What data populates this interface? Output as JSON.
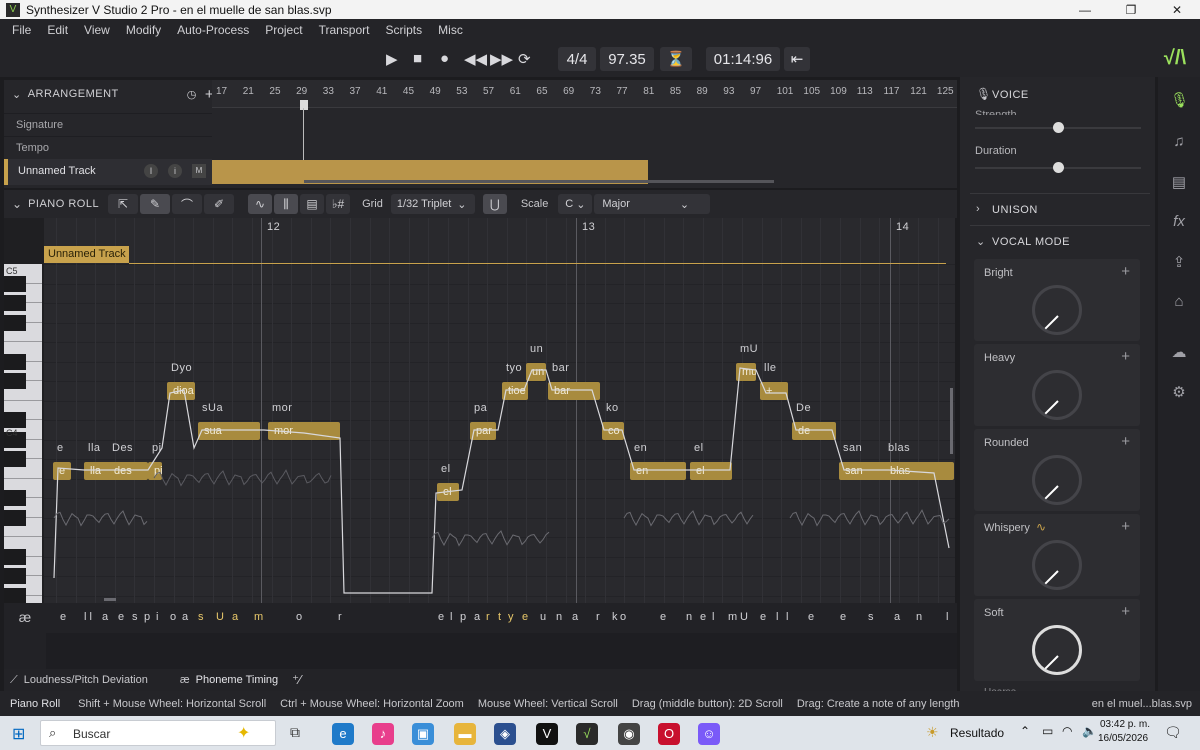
{
  "window": {
    "title": "Synthesizer V Studio 2 Pro - en el muelle de san blas.svp"
  },
  "menu": [
    "File",
    "Edit",
    "View",
    "Modify",
    "Auto-Process",
    "Project",
    "Transport",
    "Scripts",
    "Misc"
  ],
  "transport": {
    "time_signature": "4/4",
    "tempo": "97.35",
    "position": "01:14:96"
  },
  "arrangement": {
    "title": "ARRANGEMENT",
    "rows": [
      "Signature",
      "Tempo"
    ],
    "track_name": "Unnamed Track",
    "track_btns": [
      "I",
      "i",
      "M"
    ],
    "ruler": [
      "17",
      "21",
      "25",
      "29",
      "33",
      "37",
      "41",
      "45",
      "49",
      "53",
      "57",
      "61",
      "65",
      "69",
      "73",
      "77",
      "81",
      "85",
      "89",
      "93",
      "97",
      "101",
      "105",
      "109",
      "113",
      "117",
      "121",
      "125"
    ]
  },
  "piano_roll": {
    "title": "PIANO ROLL",
    "grid_label": "Grid",
    "grid_value": "1/32 Triplet",
    "scale_label": "Scale",
    "scale_key": "C",
    "scale_mode": "Major",
    "bars": [
      "12",
      "13",
      "14"
    ],
    "track_tag": "Unnamed Track",
    "key_c5": "C5",
    "key_c4": "C4",
    "notes": [
      {
        "lyric": "e",
        "phon": "e"
      },
      {
        "lyric": "lla",
        "phon": "lla"
      },
      {
        "lyric": "des",
        "phon": "Des"
      },
      {
        "lyric": "pi",
        "phon": "pi"
      },
      {
        "lyric": "dioa",
        "phon": "Dyo"
      },
      {
        "lyric": "sua",
        "phon": "sUa"
      },
      {
        "lyric": "mor",
        "phon": "mor"
      },
      {
        "lyric": "el",
        "phon": "el"
      },
      {
        "lyric": "par",
        "phon": "pa"
      },
      {
        "lyric": "tioe",
        "phon": "tyo"
      },
      {
        "lyric": "un",
        "phon": "un"
      },
      {
        "lyric": "bar",
        "phon": "bar"
      },
      {
        "lyric": "co",
        "phon": "ko"
      },
      {
        "lyric": "en",
        "phon": "en"
      },
      {
        "lyric": "el",
        "phon": "el"
      },
      {
        "lyric": "mu",
        "phon": "mU"
      },
      {
        "lyric": "+",
        "phon": "lle"
      },
      {
        "lyric": "de",
        "phon": "De"
      },
      {
        "lyric": "san",
        "phon": "san"
      },
      {
        "lyric": "blas",
        "phon": "blas"
      }
    ],
    "phoneme_lane": [
      "e",
      "l l",
      "a",
      "e",
      "s",
      "p",
      "i",
      "o",
      "a",
      "s",
      "U",
      "a",
      "m",
      "o",
      "r",
      "e",
      "l",
      "p",
      "a",
      "r",
      "t",
      "y",
      "e",
      "u",
      "n",
      "a",
      "r",
      "k",
      "o",
      "e",
      "n",
      "e",
      "l",
      "m",
      "U",
      "e",
      "l",
      "l",
      "e",
      "e",
      "s",
      "a",
      "n",
      "l",
      "a",
      "s"
    ]
  },
  "tabs": [
    "Loudness/Pitch Deviation",
    "Phoneme Timing"
  ],
  "voice": {
    "title": "VOICE",
    "strength": "Strength",
    "duration": "Duration",
    "unison": "UNISON",
    "vocal_mode": "VOCAL MODE",
    "modes": [
      "Bright",
      "Heavy",
      "Rounded",
      "Whispery",
      "Soft"
    ],
    "more": "Hoarse"
  },
  "status": {
    "left": "Piano Roll",
    "hints": [
      "Shift + Mouse Wheel: Horizontal Scroll",
      "Ctrl + Mouse Wheel: Horizontal Zoom",
      "Mouse Wheel: Vertical Scroll",
      "Drag (middle button): 2D Scroll",
      "Drag: Create a note of any length"
    ],
    "file": "en el muel...blas.svp"
  },
  "taskbar": {
    "search": "Buscar",
    "weather": "Resultado",
    "time": "03:42 p. m.",
    "date": "16/05/2026"
  },
  "colors": {
    "accent": "#c8a24c",
    "note": "#a88b3e",
    "logo": "#9be15d"
  }
}
